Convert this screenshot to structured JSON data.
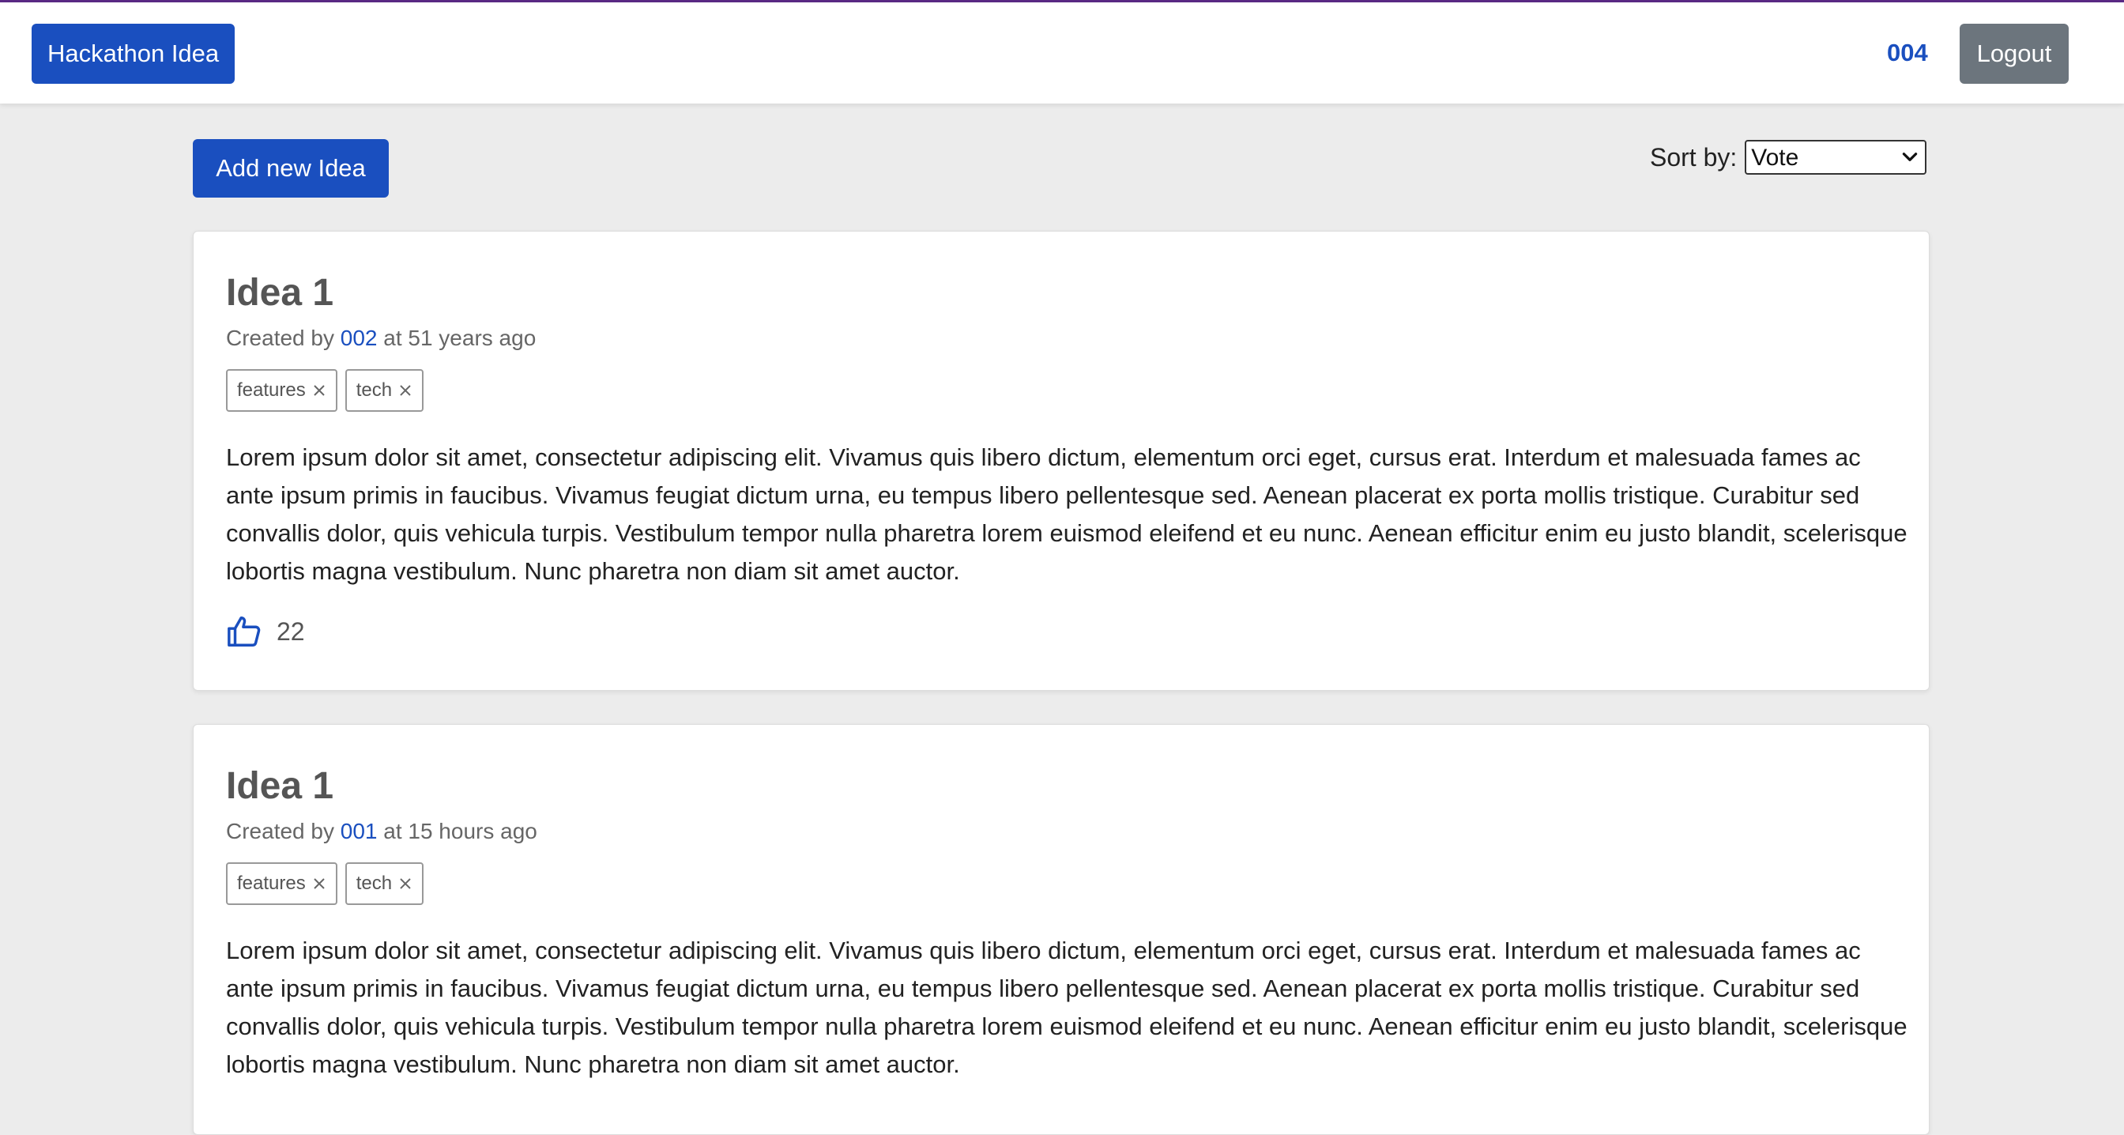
{
  "navbar": {
    "brand": "Hackathon Idea",
    "user": "004",
    "logout": "Logout"
  },
  "toolbar": {
    "add_label": "Add new Idea",
    "sort_label": "Sort by:",
    "sort_value": "Vote"
  },
  "ideas": [
    {
      "title": "Idea 1",
      "created_prefix": "Created by",
      "author": "002",
      "created_suffix": "at 51 years ago",
      "tags": [
        "features",
        "tech"
      ],
      "description": "Lorem ipsum dolor sit amet, consectetur adipiscing elit. Vivamus quis libero dictum, elementum orci eget, cursus erat. Interdum et malesuada fames ac ante ipsum primis in faucibus. Vivamus feugiat dictum urna, eu tempus libero pellentesque sed. Aenean placerat ex porta mollis tristique. Curabitur sed convallis dolor, quis vehicula turpis. Vestibulum tempor nulla pharetra lorem euismod eleifend et eu nunc. Aenean efficitur enim eu justo blandit, scelerisque lobortis magna vestibulum. Nunc pharetra non diam sit amet auctor.",
      "votes": "22"
    },
    {
      "title": "Idea 1",
      "created_prefix": "Created by",
      "author": "001",
      "created_suffix": "at 15 hours ago",
      "tags": [
        "features",
        "tech"
      ],
      "description": "Lorem ipsum dolor sit amet, consectetur adipiscing elit. Vivamus quis libero dictum, elementum orci eget, cursus erat. Interdum et malesuada fames ac ante ipsum primis in faucibus. Vivamus feugiat dictum urna, eu tempus libero pellentesque sed. Aenean placerat ex porta mollis tristique. Curabitur sed convallis dolor, quis vehicula turpis. Vestibulum tempor nulla pharetra lorem euismod eleifend et eu nunc. Aenean efficitur enim eu justo blandit, scelerisque lobortis magna vestibulum. Nunc pharetra non diam sit amet auctor."
    }
  ],
  "colors": {
    "primary": "#1a4fbf",
    "secondary": "#6c757d",
    "background": "#ececec"
  },
  "icons": {
    "tag_remove": "close-icon",
    "vote": "thumbs-up-icon",
    "select": "chevron-down-icon"
  }
}
